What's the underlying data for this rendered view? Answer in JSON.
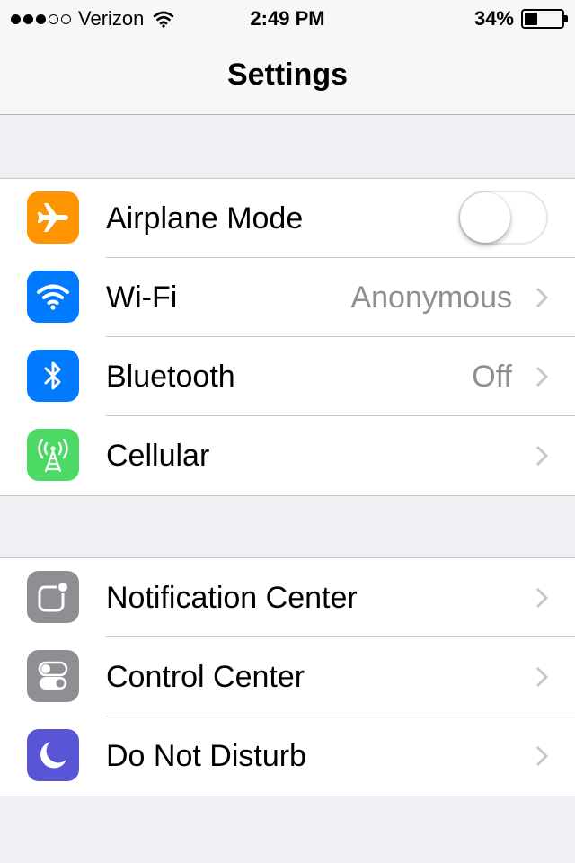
{
  "status_bar": {
    "signal_total": 5,
    "signal_filled": 3,
    "carrier": "Verizon",
    "wifi_icon": "wifi-icon",
    "time": "2:49 PM",
    "battery_percent": "34%",
    "battery_level": 0.34
  },
  "nav": {
    "title": "Settings"
  },
  "colors": {
    "airplane": "#ff9500",
    "wifi": "#007aff",
    "bluetooth": "#007aff",
    "cellular": "#4cd964",
    "notification": "#8e8e93",
    "control": "#8e8e93",
    "dnd": "#5856d6"
  },
  "group1": {
    "items": [
      {
        "label": "Airplane Mode",
        "icon": "airplane-icon",
        "toggle_on": false
      },
      {
        "label": "Wi-Fi",
        "value": "Anonymous",
        "icon": "wifi-icon"
      },
      {
        "label": "Bluetooth",
        "value": "Off",
        "icon": "bluetooth-icon"
      },
      {
        "label": "Cellular",
        "icon": "cellular-antenna-icon"
      }
    ]
  },
  "group2": {
    "items": [
      {
        "label": "Notification Center",
        "icon": "notification-center-icon"
      },
      {
        "label": "Control Center",
        "icon": "control-center-icon"
      },
      {
        "label": "Do Not Disturb",
        "icon": "moon-icon"
      }
    ]
  }
}
